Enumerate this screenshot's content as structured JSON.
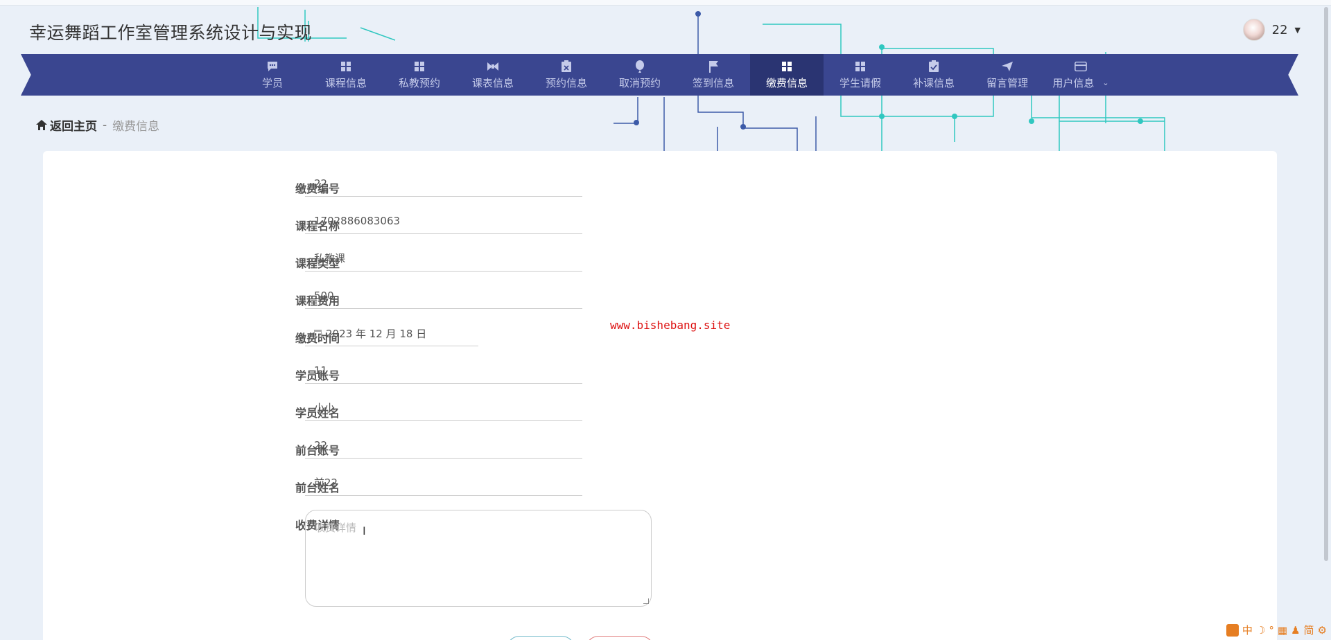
{
  "app": {
    "title": "幸运舞蹈工作室管理系统设计与实现"
  },
  "user": {
    "name": "22"
  },
  "nav": {
    "items": [
      {
        "label": "学员",
        "icon": "chat-icon"
      },
      {
        "label": "课程信息",
        "icon": "grid-icon"
      },
      {
        "label": "私教预约",
        "icon": "grid-icon"
      },
      {
        "label": "课表信息",
        "icon": "bowtie-icon"
      },
      {
        "label": "预约信息",
        "icon": "clipboard-x-icon"
      },
      {
        "label": "取消预约",
        "icon": "balloon-icon"
      },
      {
        "label": "签到信息",
        "icon": "flag-icon"
      },
      {
        "label": "缴费信息",
        "icon": "grid-icon",
        "active": true
      },
      {
        "label": "学生请假",
        "icon": "grid-icon"
      },
      {
        "label": "补课信息",
        "icon": "clipboard-check-icon"
      },
      {
        "label": "留言管理",
        "icon": "send-icon"
      },
      {
        "label": "用户信息",
        "icon": "card-icon"
      }
    ]
  },
  "breadcrumb": {
    "home": "返回主页",
    "separator": "-",
    "current": "缴费信息"
  },
  "form": {
    "fields": [
      {
        "label": "缴费编号",
        "value": "22"
      },
      {
        "label": "课程名称",
        "value": "1702886083063"
      },
      {
        "label": "课程类型",
        "value": "私教课"
      },
      {
        "label": "课程费用",
        "value": "500"
      },
      {
        "label": "缴费时间",
        "value": "2023 年 12 月 18 日"
      },
      {
        "label": "学员账号",
        "value": "11"
      },
      {
        "label": "学员姓名",
        "value": "小小"
      },
      {
        "label": "前台账号",
        "value": "22"
      },
      {
        "label": "前台姓名",
        "value": "前22"
      },
      {
        "label": "收费详情",
        "placeholder": "收费详情"
      }
    ]
  },
  "watermark": "www.bishebang.site",
  "ime": {
    "items": [
      "中",
      "简"
    ]
  },
  "colors": {
    "nav_bg": "#3a4690",
    "nav_active": "#2a3472",
    "accent": "#2ec4b6"
  }
}
